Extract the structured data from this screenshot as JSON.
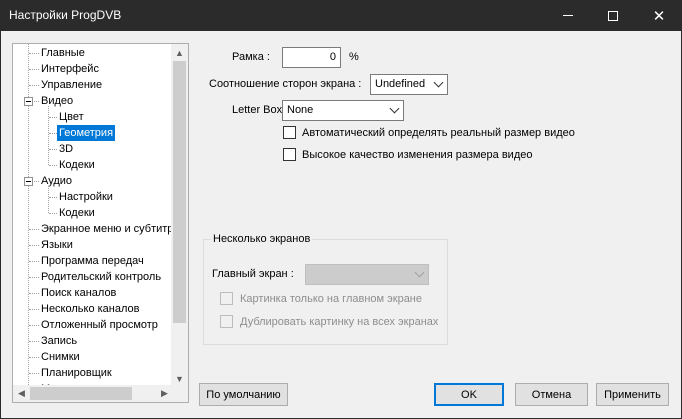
{
  "window": {
    "title": "Настройки ProgDVB"
  },
  "titlebar_icons": {
    "minimize": "minimize-icon",
    "maximize": "maximize-icon",
    "close": "close-icon"
  },
  "tree": {
    "items": [
      {
        "label": "Главные",
        "level": 0
      },
      {
        "label": "Интерфейс",
        "level": 0
      },
      {
        "label": "Управление",
        "level": 0
      },
      {
        "label": "Видео",
        "level": 0,
        "expanded": true
      },
      {
        "label": "Цвет",
        "level": 1
      },
      {
        "label": "Геометрия",
        "level": 1,
        "selected": true
      },
      {
        "label": "3D",
        "level": 1
      },
      {
        "label": "Кодеки",
        "level": 1
      },
      {
        "label": "Аудио",
        "level": 0,
        "expanded": true
      },
      {
        "label": "Настройки",
        "level": 1
      },
      {
        "label": "Кодеки",
        "level": 1
      },
      {
        "label": "Экранное меню и субтитры",
        "level": 0
      },
      {
        "label": "Языки",
        "level": 0
      },
      {
        "label": "Программа передач",
        "level": 0
      },
      {
        "label": "Родительский контроль",
        "level": 0
      },
      {
        "label": "Поиск каналов",
        "level": 0
      },
      {
        "label": "Несколько каналов",
        "level": 0
      },
      {
        "label": "Отложенный просмотр",
        "level": 0
      },
      {
        "label": "Запись",
        "level": 0
      },
      {
        "label": "Снимки",
        "level": 0
      },
      {
        "label": "Планировщик",
        "level": 0
      },
      {
        "label": "М...",
        "level": 0
      }
    ]
  },
  "geometry": {
    "frame_label": "Рамка :",
    "frame_value": "0",
    "frame_unit": "%",
    "aspect_label": "Соотношение сторон экрана :",
    "aspect_value": "Undefined",
    "letterbox_label": "Letter Box :",
    "letterbox_value": "None",
    "auto_detect_label": "Автоматический определять реальный размер видео",
    "auto_detect_checked": false,
    "hq_resize_label": "Высокое качество изменения размера видео",
    "hq_resize_checked": false
  },
  "multi_screen": {
    "group_title": "Несколько экранов",
    "main_screen_label": "Главный экран :",
    "main_screen_value": "",
    "picture_main_only_label": "Картинка только на главном экране",
    "duplicate_label": "Дублировать картинку на всех экранах"
  },
  "buttons": {
    "defaults": "По умолчанию",
    "ok": "OK",
    "cancel": "Отмена",
    "apply": "Применить"
  },
  "colors": {
    "selection": "#0078d7",
    "titlebar": "#2b2b2b",
    "background": "#f0f0f0"
  }
}
